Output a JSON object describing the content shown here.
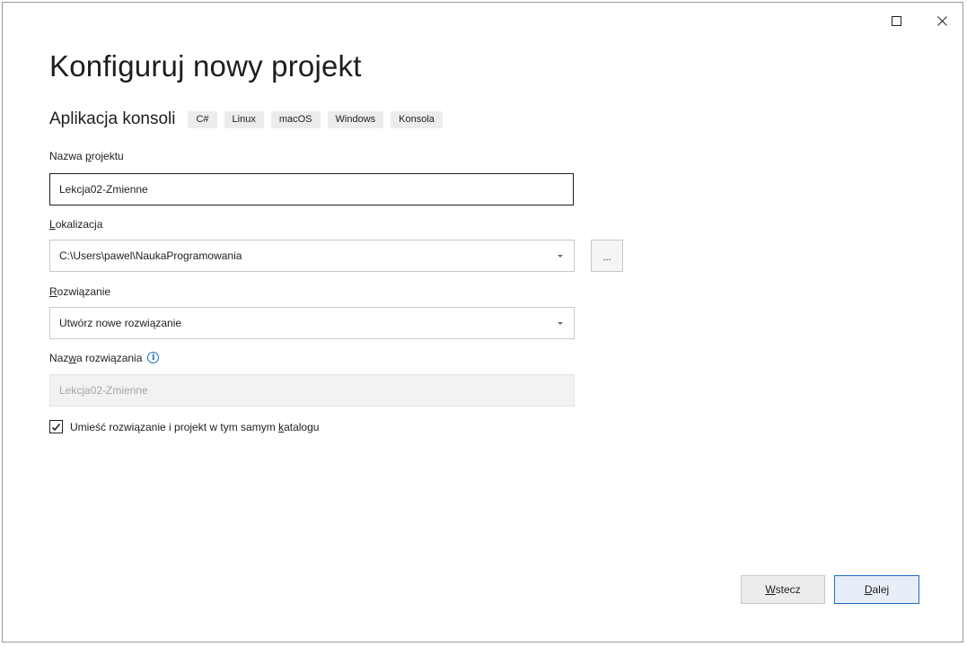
{
  "window": {
    "maximize_icon": "maximize-icon",
    "close_icon": "close-icon"
  },
  "page_title": "Konfiguruj nowy projekt",
  "template": {
    "name": "Aplikacja konsoli",
    "tags": [
      "C#",
      "Linux",
      "macOS",
      "Windows",
      "Konsola"
    ]
  },
  "project_name": {
    "label_pre": "Nazwa ",
    "label_access": "p",
    "label_post": "rojektu",
    "value": "Lekcja02-Zmienne"
  },
  "location": {
    "label_access": "L",
    "label_post": "okalizacja",
    "value": "C:\\Users\\pawel\\NaukaProgramowania",
    "browse_label": "..."
  },
  "solution": {
    "label_access": "R",
    "label_post": "ozwiązanie",
    "value": "Utwórz nowe rozwiązanie"
  },
  "solution_name": {
    "label_pre": "Naz",
    "label_access": "w",
    "label_post": "a rozwiązania",
    "info_icon": "info-icon",
    "info_glyph": "i",
    "value": "Lekcja02-Zmienne"
  },
  "same_dir": {
    "checked": true,
    "label_pre": "Umieść rozwiązanie i projekt w tym samym ",
    "label_access": "k",
    "label_post": "atalogu"
  },
  "buttons": {
    "back_access": "W",
    "back_post": "stecz",
    "next_access": "D",
    "next_post": "alej"
  }
}
